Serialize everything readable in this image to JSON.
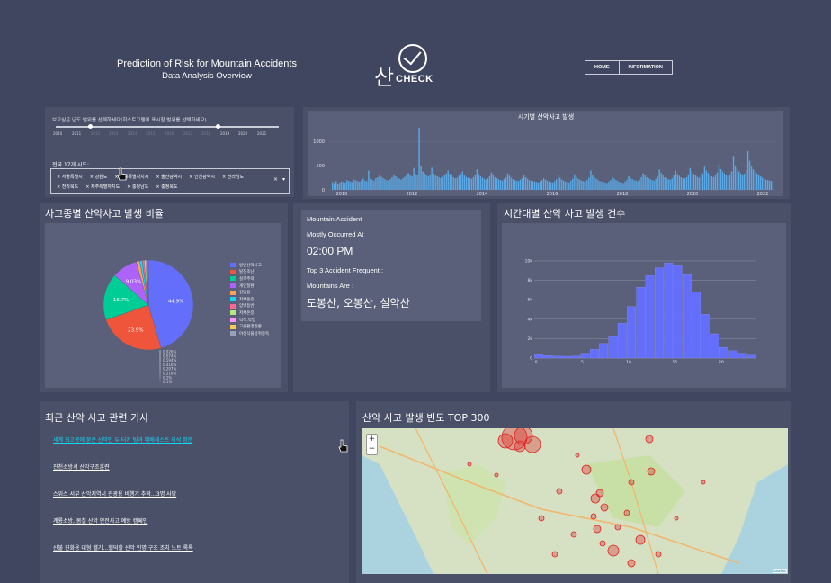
{
  "header": {
    "title": "Prediction of Risk for Mountain Accidents",
    "subtitle": "Data Analysis Overview",
    "logo_han": "산",
    "logo_word": "CHECK",
    "nav": [
      "HOME",
      "INFORMATION"
    ]
  },
  "filter": {
    "year_label": "보고싶은 년도 범위를 선택하세요(히스토그램에 표시할 범위를 선택하세요)",
    "years": [
      "2010",
      "2011",
      "2012",
      "2013",
      "2014",
      "2015",
      "2016",
      "2017",
      "2018",
      "2019",
      "2020",
      "2021"
    ],
    "region_label": "전국 17개 시도:",
    "regions_row1": [
      "서울특별시",
      "강원도",
      "세종특별자치시",
      "울산광역시",
      "인천광역시",
      "전라남도"
    ],
    "regions_row2": [
      "전라북도",
      "제주특별자치도",
      "충청남도",
      "충청북도"
    ],
    "clear": "×",
    "dropdown": "▾"
  },
  "timeline": {
    "title": "시기별 산악사고 발생",
    "y_ticks": [
      "1000",
      "500",
      "0"
    ],
    "x_ticks": [
      "2010",
      "2012",
      "2014",
      "2016",
      "2018",
      "2020",
      "2022"
    ]
  },
  "pie": {
    "title": "사고종별 산악사고 발생 비율",
    "labels": [
      "일반산악사고",
      "탈진조난",
      "실족추락",
      "개인질환",
      "길잃음",
      "저체온증",
      "암벽등반",
      "저체온증",
      "낙석,낙빙",
      "고온환경질환",
      "야생식물섭취중독"
    ],
    "colors": [
      "#636efa",
      "#ef553b",
      "#00cc96",
      "#ab63fa",
      "#ffa15a",
      "#19d3f3",
      "#ff6692",
      "#b6e880",
      "#ff97ff",
      "#fecb52",
      "#9aa0b8"
    ],
    "pct_labels": [
      "44.9%",
      "23.9%",
      "16.7%",
      "9.03%"
    ],
    "small_labels": [
      "0.926%",
      "0.674%",
      "0.594%",
      "0.416%",
      "0.297%",
      "0.218%",
      "0.2%",
      "0.1%"
    ]
  },
  "info": {
    "line1": "Mountain Accident",
    "line2": "Mostly Occurred At",
    "time": "02:00 PM",
    "line3": "Top 3 Accident Frequent :",
    "line4": "Mountains Are :",
    "mountains": "도봉산, 오봉산, 설악산"
  },
  "hourly": {
    "title": "시간대별 산악 사고 발생 건수",
    "y_ticks": [
      "10k",
      "8k",
      "6k",
      "4k",
      "2k",
      "0"
    ],
    "x_ticks": [
      "0",
      "5",
      "10",
      "15",
      "20"
    ]
  },
  "news": {
    "title": "최근 산악 사고 관련 기사",
    "items": [
      "세계 최고봉에 묻은 산악인 두 터키 팀과 에베레스트 의석 정문",
      "진천소방서 산악구조훈련",
      "스위스 서부 산악지역서 관광용 비행기 추락…3명 사망",
      "계룡소방, 봄철 산악 안전사고 예방 캠페인",
      "산불 진화용 대형 헬기…헬덕할 산악 인명 구조 조치 노트 록록"
    ]
  },
  "map": {
    "title": "산악 사고 발생 빈도 TOP 300",
    "zoom_in": "+",
    "zoom_out": "−",
    "attribution": "Leaflet"
  },
  "chart_data": [
    {
      "type": "bar",
      "title": "시기별 산악사고 발생",
      "xlabel": "",
      "ylabel": "",
      "ylim": [
        0,
        1300
      ],
      "x": [
        "2010",
        "2012",
        "2014",
        "2016",
        "2018",
        "2020",
        "2022"
      ],
      "values": [
        160,
        140,
        180,
        130,
        150,
        170,
        160,
        150,
        200,
        180,
        170,
        160,
        210,
        190,
        180,
        170,
        200,
        230,
        190,
        180,
        400,
        230,
        210,
        190,
        240,
        260,
        300,
        270,
        240,
        220,
        200,
        190,
        220,
        260,
        320,
        280,
        250,
        230,
        210,
        240,
        270,
        310,
        350,
        300,
        280,
        450,
        330,
        300,
        1280,
        500,
        380,
        340,
        300,
        280,
        320,
        460,
        340,
        300,
        280,
        260,
        250,
        270,
        300,
        340,
        400,
        330,
        300,
        260,
        240,
        250,
        290,
        330,
        380,
        310,
        270,
        250,
        240,
        230,
        260,
        300,
        420,
        330,
        280,
        250,
        230,
        210,
        240,
        280,
        360,
        300,
        260,
        240,
        220,
        200,
        190,
        220,
        260,
        340,
        290,
        250,
        220,
        200,
        190,
        180,
        210,
        240,
        300,
        260,
        230,
        200,
        190,
        180,
        170,
        160,
        150,
        180,
        200,
        240,
        210,
        190,
        170,
        160,
        150,
        180,
        220,
        300,
        250,
        210,
        190,
        170,
        160,
        150,
        190,
        230,
        320,
        270,
        230,
        210,
        190,
        180,
        170,
        200,
        250,
        400,
        300,
        260,
        230,
        200,
        180,
        170,
        160,
        150,
        140,
        170,
        200,
        260,
        230,
        200,
        180,
        160,
        150,
        140,
        170,
        210,
        280,
        240,
        220,
        200,
        190,
        180,
        210,
        260,
        340,
        300,
        260,
        240,
        220,
        200,
        190,
        230,
        280,
        420,
        350,
        300,
        260,
        240,
        220,
        210,
        240,
        300,
        400,
        330,
        290,
        260,
        240,
        230,
        260,
        320,
        450,
        380,
        330,
        300,
        270,
        250,
        280,
        340,
        480,
        400,
        350,
        310,
        280,
        260,
        300,
        360,
        520,
        430,
        380,
        340,
        300,
        280,
        320,
        380,
        700,
        500,
        420,
        380,
        340,
        300,
        330,
        400,
        800,
        600,
        480,
        420,
        380,
        340,
        300,
        280,
        250,
        230,
        210,
        200,
        190,
        180
      ]
    },
    {
      "type": "pie",
      "title": "사고종별 산악사고 발생 비율",
      "labels": [
        "일반산악사고",
        "탈진조난",
        "실족추락",
        "개인질환",
        "길잃음",
        "저체온증",
        "암벽등반",
        "저체온증",
        "낙석,낙빙",
        "고온환경질환",
        "야생식물섭취중독"
      ],
      "values": [
        44.9,
        23.9,
        16.7,
        9.03,
        1.2,
        0.926,
        0.674,
        0.594,
        0.416,
        0.297,
        0.2
      ]
    },
    {
      "type": "bar",
      "title": "시간대별 산악 사고 발생 건수",
      "xlabel": "",
      "ylabel": "",
      "ylim": [
        0,
        10000
      ],
      "x": [
        0,
        1,
        2,
        3,
        4,
        5,
        6,
        7,
        8,
        9,
        10,
        11,
        12,
        13,
        14,
        15,
        16,
        17,
        18,
        19,
        20,
        21,
        22,
        23
      ],
      "values": [
        350,
        250,
        200,
        180,
        200,
        500,
        900,
        1500,
        2200,
        3600,
        5300,
        7300,
        8500,
        9300,
        9800,
        9500,
        8600,
        6800,
        4500,
        2500,
        1100,
        750,
        500,
        300
      ]
    }
  ]
}
